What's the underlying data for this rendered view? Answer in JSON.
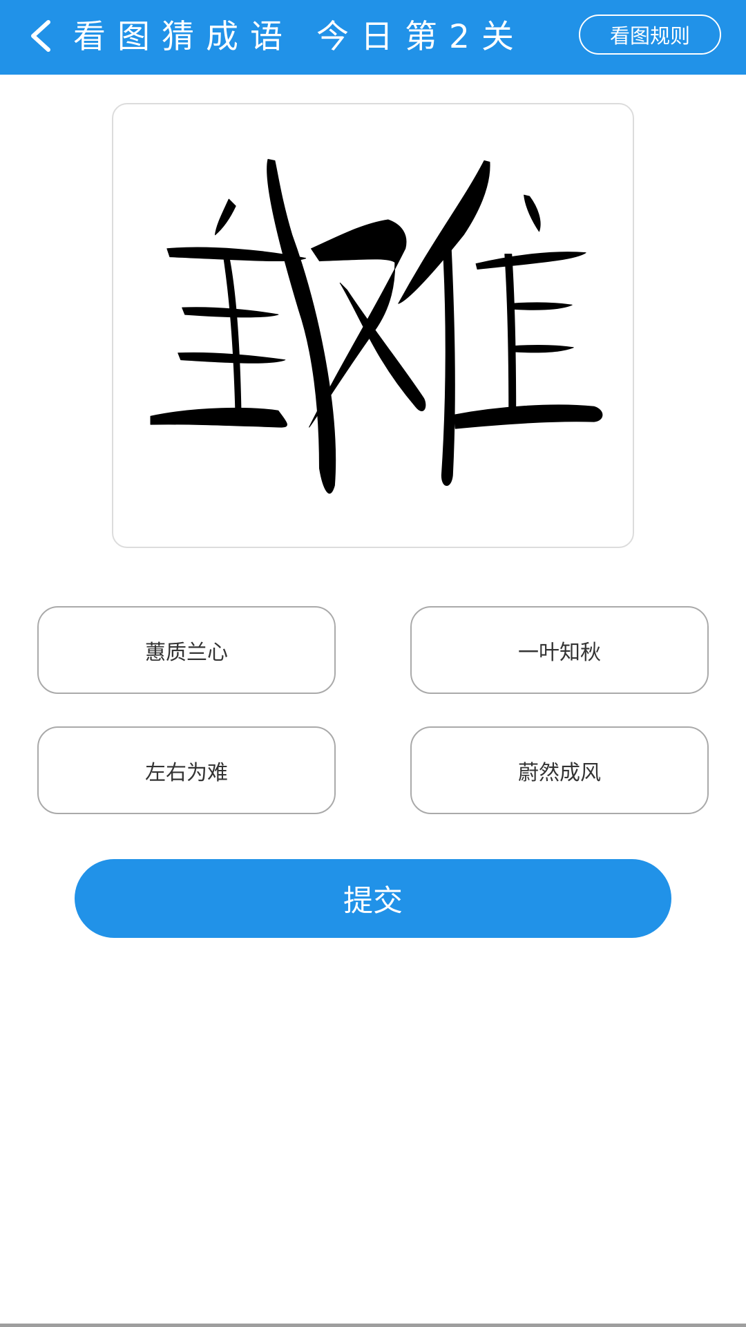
{
  "header": {
    "title": "看图猜成语 今日第2关",
    "rules_label": "看图规则",
    "back_icon": "chevron-left-icon"
  },
  "puzzle": {
    "image": "character-puzzle-image"
  },
  "options": [
    {
      "label": "蕙质兰心"
    },
    {
      "label": "一叶知秋"
    },
    {
      "label": "左右为难"
    },
    {
      "label": "蔚然成风"
    }
  ],
  "submit": {
    "label": "提交"
  },
  "colors": {
    "primary": "#2192e8",
    "option_border": "#a9a9a9",
    "card_border": "#dcdcdc",
    "text_dark": "#333333"
  }
}
